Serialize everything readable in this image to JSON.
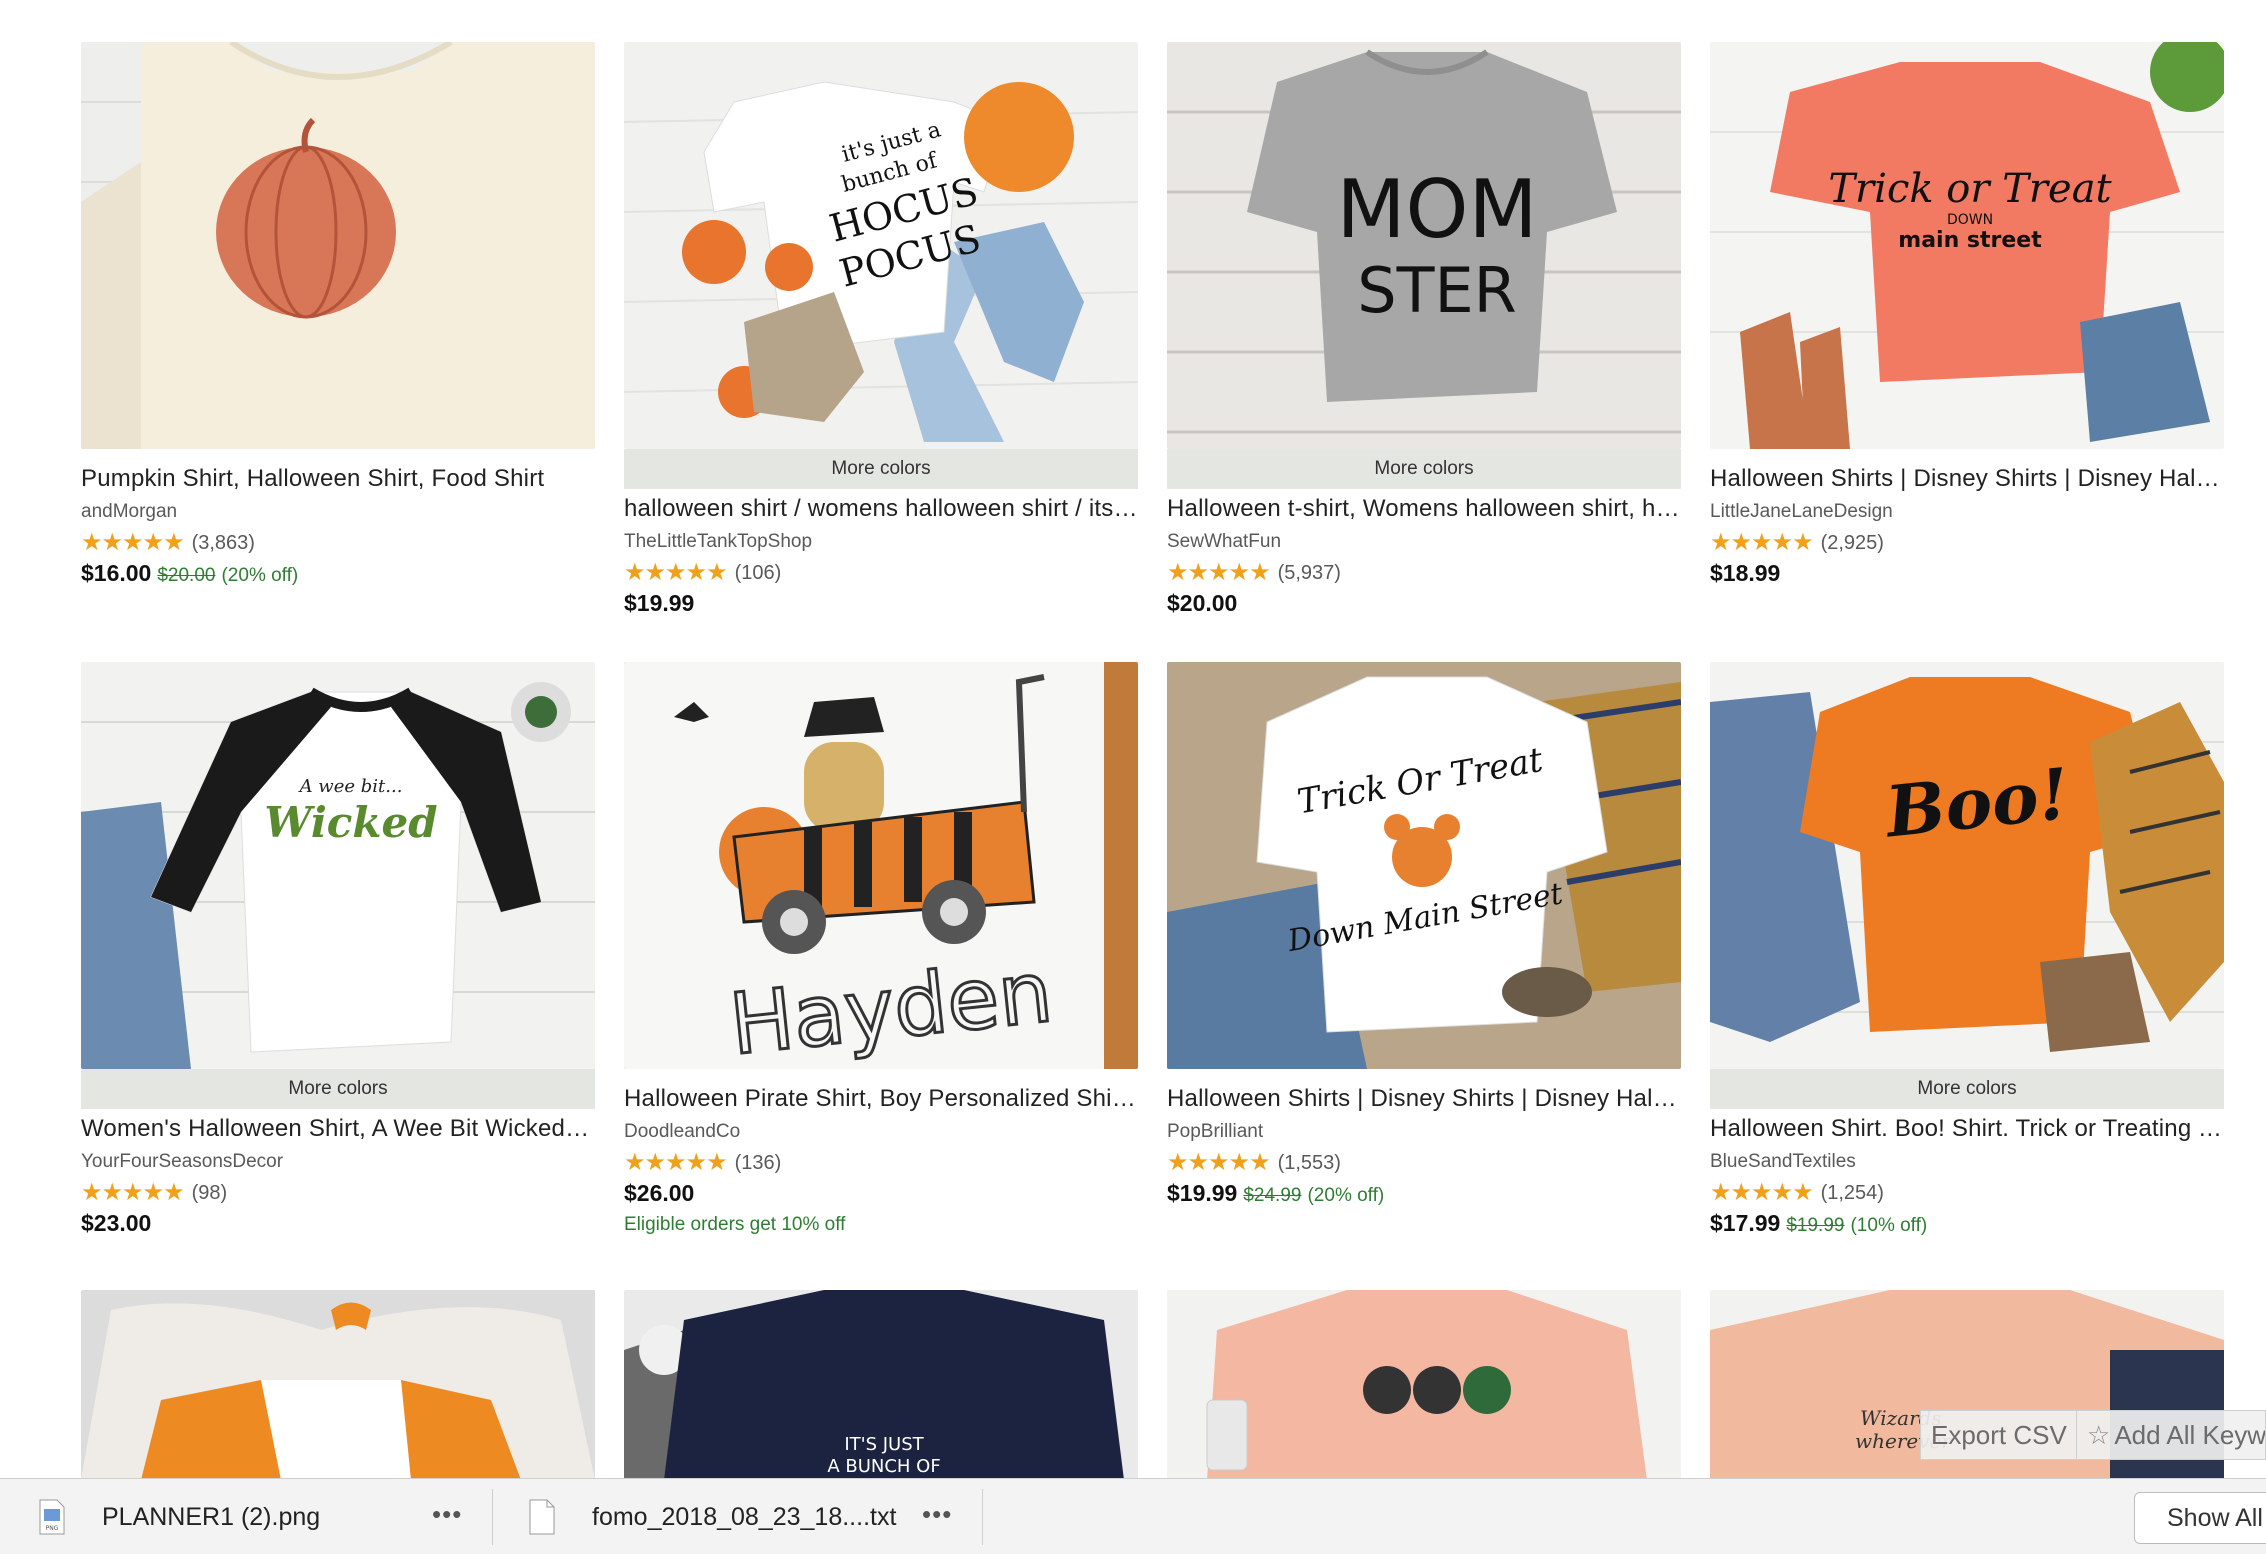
{
  "listings": [
    {
      "title": "Pumpkin Shirt, Halloween Shirt, Food Shirt",
      "shop": "andMorgan",
      "stars": "★★★★★",
      "reviews": "(3,863)",
      "price": "$16.00",
      "original_price": "$20.00",
      "discount": "(20% off)",
      "more_colors": "",
      "promo": ""
    },
    {
      "title": "halloween shirt / womens halloween shirt / its ...",
      "shop": "TheLittleTankTopShop",
      "stars": "★★★★★",
      "reviews": "(106)",
      "price": "$19.99",
      "original_price": "",
      "discount": "",
      "more_colors": "More colors",
      "promo": ""
    },
    {
      "title": "Halloween t-shirt, Womens halloween shirt, ha...",
      "shop": "SewWhatFun",
      "stars": "★★★★★",
      "reviews": "(5,937)",
      "price": "$20.00",
      "original_price": "",
      "discount": "",
      "more_colors": "More colors",
      "promo": ""
    },
    {
      "title": "Halloween Shirts | Disney Shirts | Disney Hallo...",
      "shop": "LittleJaneLaneDesign",
      "stars": "★★★★★",
      "reviews": "(2,925)",
      "price": "$18.99",
      "original_price": "",
      "discount": "",
      "more_colors": "",
      "promo": ""
    },
    {
      "title": "Women's Halloween Shirt, A Wee Bit Wicked S...",
      "shop": "YourFourSeasonsDecor",
      "stars": "★★★★★",
      "reviews": "(98)",
      "price": "$23.00",
      "original_price": "",
      "discount": "",
      "more_colors": "More colors",
      "promo": ""
    },
    {
      "title": "Halloween Pirate Shirt, Boy Personalized Shirt,...",
      "shop": "DoodleandCo",
      "stars": "★★★★★",
      "reviews": "(136)",
      "price": "$26.00",
      "original_price": "",
      "discount": "",
      "more_colors": "",
      "promo": "Eligible orders get 10% off"
    },
    {
      "title": "Halloween Shirts | Disney Shirts | Disney Hallo...",
      "shop": "PopBrilliant",
      "stars": "★★★★★",
      "reviews": "(1,553)",
      "price": "$19.99",
      "original_price": "$24.99",
      "discount": "(20% off)",
      "more_colors": "",
      "promo": ""
    },
    {
      "title": "Halloween Shirt. Boo! Shirt. Trick or Treating T...",
      "shop": "BlueSandTextiles",
      "stars": "★★★★★",
      "reviews": "(1,254)",
      "price": "$17.99",
      "original_price": "$19.99",
      "discount": "(10% off)",
      "more_colors": "More colors",
      "promo": ""
    }
  ],
  "shirt_prints": {
    "hocus": [
      "it's just a",
      "bunch of",
      "HOCUS",
      "POCUS"
    ],
    "momster": [
      "MOM",
      "STER"
    ],
    "trick": [
      "Trick or Treat",
      "DOWN",
      "main street"
    ],
    "wicked": [
      "A wee bit...",
      "Wicked"
    ],
    "hayden": "Hayden",
    "trick2": [
      "Trick Or Treat",
      "Down Main Street"
    ],
    "boo": "Boo!",
    "row3_b": [
      "IT'S JUST",
      "A BUNCH OF"
    ],
    "row3_d": [
      "Wizards",
      "wherever"
    ]
  },
  "overlay": {
    "export_csv": "Export CSV",
    "add_all_keywords": "Add All Keyw"
  },
  "downloads": {
    "items": [
      {
        "name": "PLANNER1 (2).png",
        "ext": "PNG",
        "more": "•••"
      },
      {
        "name": "fomo_2018_08_23_18....txt",
        "ext": "",
        "more": "•••"
      }
    ],
    "show_all": "Show All"
  },
  "colors": {
    "star": "#f1a01a",
    "sale_green": "#2f7d32",
    "more_colors_bg": "#e3e6e1"
  }
}
